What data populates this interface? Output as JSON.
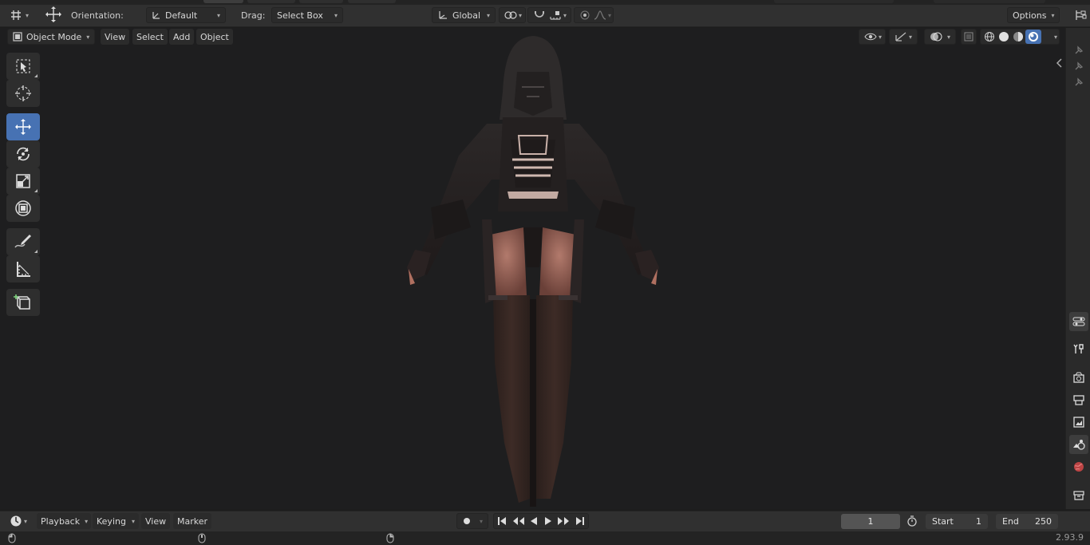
{
  "header": {
    "orientation_label": "Orientation:",
    "orientation_value": "Default",
    "drag_label": "Drag:",
    "drag_value": "Select Box",
    "transform_orientation": "Global",
    "options_label": "Options"
  },
  "viewport_header": {
    "mode": "Object Mode",
    "menus": [
      "View",
      "Select",
      "Add",
      "Object"
    ]
  },
  "timeline": {
    "menus": [
      "Playback",
      "Keying",
      "View",
      "Marker"
    ],
    "current_frame": "1",
    "start_label": "Start",
    "start_value": "1",
    "end_label": "End",
    "end_value": "250"
  },
  "status": {
    "version": "2.93.9"
  },
  "colors": {
    "accent": "#4772b3",
    "header_bg": "#303030",
    "viewport_bg": "#1e1e1f"
  },
  "icons": {
    "toolbar": [
      "select-box-icon",
      "cursor-icon",
      "move-icon",
      "rotate-icon",
      "scale-icon",
      "transform-icon",
      "annotate-icon",
      "measure-icon",
      "add-cube-icon"
    ],
    "properties": [
      "tool-icon",
      "render-icon",
      "output-icon",
      "view-layer-icon",
      "scene-icon",
      "world-icon",
      "collection-icon",
      "object-icon"
    ]
  }
}
